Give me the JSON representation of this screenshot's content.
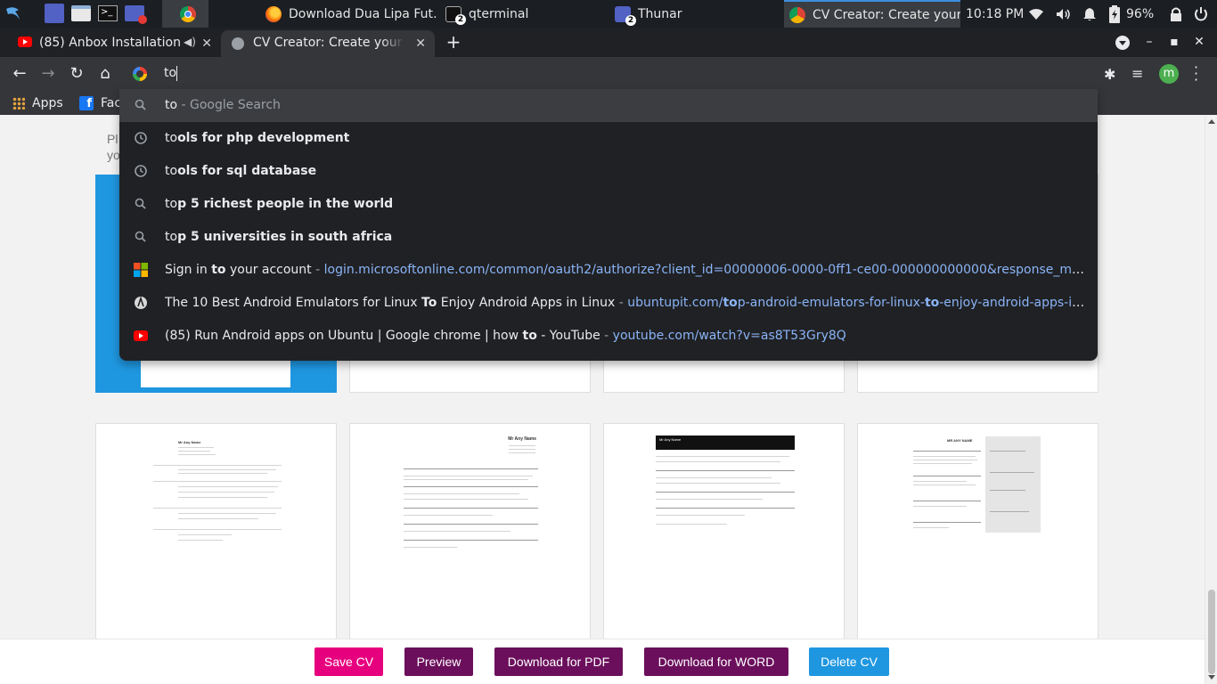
{
  "taskbar": {
    "tasks": [
      {
        "label": "Download Dua Lipa Fut…"
      },
      {
        "label": "qterminal",
        "badge": "2"
      },
      {
        "label": "Thunar",
        "badge": "2"
      },
      {
        "label": "CV Creator: Create your…"
      }
    ],
    "clock": "10:18 PM",
    "battery": "96%"
  },
  "tabs": [
    {
      "title": "(85) Anbox Installation"
    },
    {
      "title": "CV Creator: Create your own"
    }
  ],
  "omnibox": {
    "text": "to"
  },
  "bookmarks": [
    {
      "label": "Apps"
    },
    {
      "label": "Fac"
    }
  ],
  "suggestions": [
    {
      "match": "to",
      "rest": "",
      "hint": " - Google Search",
      "url_pre": "",
      "url_match": "",
      "url_post": ""
    },
    {
      "match": "to",
      "rest": "ols for php development"
    },
    {
      "match": "to",
      "rest": "ols for sql database"
    },
    {
      "match": "to",
      "rest": "p 5 richest people in the world"
    },
    {
      "match": "to",
      "rest": "p 5 universities in south africa"
    },
    {
      "pre": "Sign in ",
      "match": "to",
      "post": " your account",
      "sep": " - ",
      "url": "login.microsoftonline.com/common/oauth2/authorize?client_id=00000006-0000-0ff1-ce00-000000000000&response_mode=form_p…"
    },
    {
      "pre": "The 10 Best Android Emulators for Linux ",
      "match": "To",
      "post": " Enjoy Android Apps in Linux",
      "sep": " - ",
      "url_a": "ubuntupit.com/",
      "url_b": "to",
      "url_c": "p-android-emulators-for-linux-",
      "url_d": "to",
      "url_e": "-enjoy-android-apps-in-linux/"
    },
    {
      "pre": "(85) Run Android apps on Ubuntu | Google chrome | how ",
      "match": "to",
      "post": " - YouTube",
      "sep": " - ",
      "url": "youtube.com/watch?v=as8T53Gry8Q"
    }
  ],
  "page": {
    "intro_line1": "Pl",
    "intro_line2": "yo",
    "templates": [
      {
        "name": "Mr Any Name"
      },
      {
        "name": "Mr Any Name"
      },
      {
        "name": "Mr Any Name"
      },
      {
        "name": "MR ANY NAME"
      }
    ]
  },
  "actions": {
    "save": "Save CV",
    "preview": "Preview",
    "pdf": "Download for PDF",
    "word": "Download for WORD",
    "delete": "Delete CV"
  },
  "colors": {
    "save": "#e6007e",
    "preview": "#6b0f5c",
    "pdf": "#6b0f5c",
    "word": "#6b0f5c",
    "delete": "#1f97e0"
  }
}
